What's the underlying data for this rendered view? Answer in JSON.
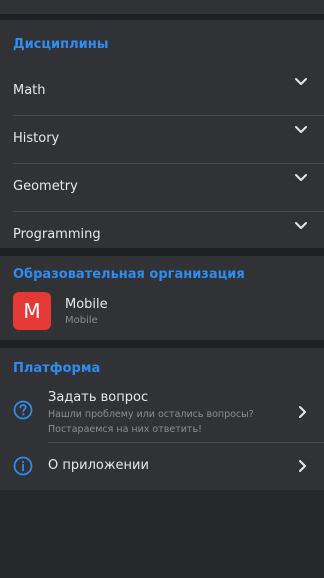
{
  "disciplines": {
    "title": "Дисциплины",
    "items": [
      {
        "label": "Math"
      },
      {
        "label": "History"
      },
      {
        "label": "Geometry"
      },
      {
        "label": "Programming"
      }
    ]
  },
  "organization": {
    "title": "Образовательная организация",
    "logo_letter": "M",
    "name": "Mobile",
    "subtitle": "Mobile"
  },
  "platform": {
    "title": "Платформа",
    "ask": {
      "title": "Задать вопрос",
      "subtitle": "Нашли проблему или остались вопросы? Постараемся на них ответить!"
    },
    "about": {
      "title": "О приложении"
    }
  },
  "colors": {
    "accent": "#2f8cf0",
    "logo": "#e53935",
    "background": "#27282c",
    "card": "#313236"
  }
}
